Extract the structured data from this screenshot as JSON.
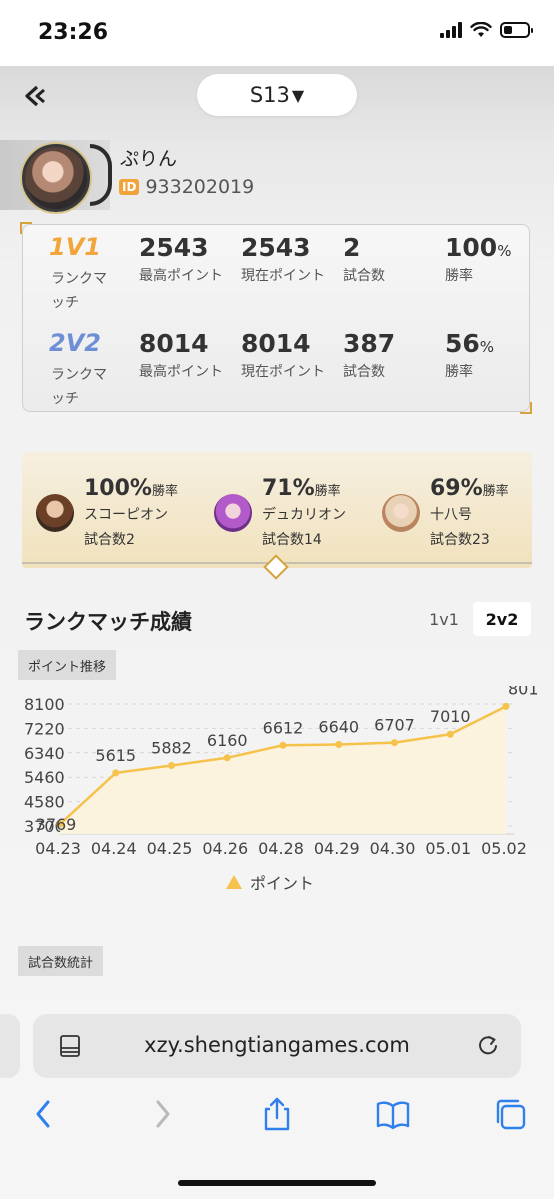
{
  "status_bar": {
    "time": "23:26",
    "battery_level": 0.35
  },
  "header": {
    "season": "S13",
    "season_caret": "▼"
  },
  "profile": {
    "username": "ぷりん",
    "id_badge": "ID",
    "id_number": "933202019"
  },
  "stats": {
    "rows": [
      {
        "mode": "1V1",
        "mode_sub": "ランクマッチ",
        "max_points": "2543",
        "max_points_label": "最高ポイント",
        "current_points": "2543",
        "current_points_label": "現在ポイント",
        "games": "2",
        "games_label": "試合数",
        "win_rate": "100",
        "win_rate_unit": "%",
        "win_rate_label": "勝率"
      },
      {
        "mode": "2V2",
        "mode_sub": "ランクマッチ",
        "max_points": "8014",
        "max_points_label": "最高ポイント",
        "current_points": "8014",
        "current_points_label": "現在ポイント",
        "games": "387",
        "games_label": "試合数",
        "win_rate": "56",
        "win_rate_unit": "%",
        "win_rate_label": "勝率"
      }
    ]
  },
  "heroes": [
    {
      "rate": "100%",
      "rate_label": "勝率",
      "name": "スコーピオン",
      "games": "試合数2"
    },
    {
      "rate": "71%",
      "rate_label": "勝率",
      "name": "デュカリオン",
      "games": "試合数14"
    },
    {
      "rate": "69%",
      "rate_label": "勝率",
      "name": "十八号",
      "games": "試合数23"
    }
  ],
  "section": {
    "title": "ランクマッチ成績",
    "tab_1v1": "1v1",
    "tab_2v2": "2v2"
  },
  "tags": {
    "points_trend": "ポイント推移",
    "games_stats": "試合数統計"
  },
  "chart_data": {
    "type": "area",
    "x": [
      "04.23",
      "04.24",
      "04.25",
      "04.26",
      "04.28",
      "04.29",
      "04.30",
      "05.01",
      "05.02"
    ],
    "series": [
      {
        "name": "ポイント",
        "values": [
          3769,
          5615,
          5882,
          6160,
          6612,
          6640,
          6707,
          7010,
          8014
        ],
        "labels": [
          "3769",
          "5615",
          "5882",
          "6160",
          "6612",
          "6640",
          "6707",
          "7010",
          "801"
        ]
      }
    ],
    "yticks": [
      "8100",
      "7220",
      "6340",
      "5460",
      "4580",
      "3700"
    ],
    "ylim": [
      3700,
      8100
    ],
    "grid": true,
    "legend": "bottom-center",
    "colors": {
      "line": "#f5c24b",
      "fill": "#fdf3dc",
      "grid": "#d6d6d6"
    }
  },
  "browser": {
    "url": "xzy.shengtiangames.com"
  },
  "colors": {
    "accent": "#f2a53a",
    "mode2": "#6e8fd6",
    "ios_blue": "#2f80ed"
  }
}
